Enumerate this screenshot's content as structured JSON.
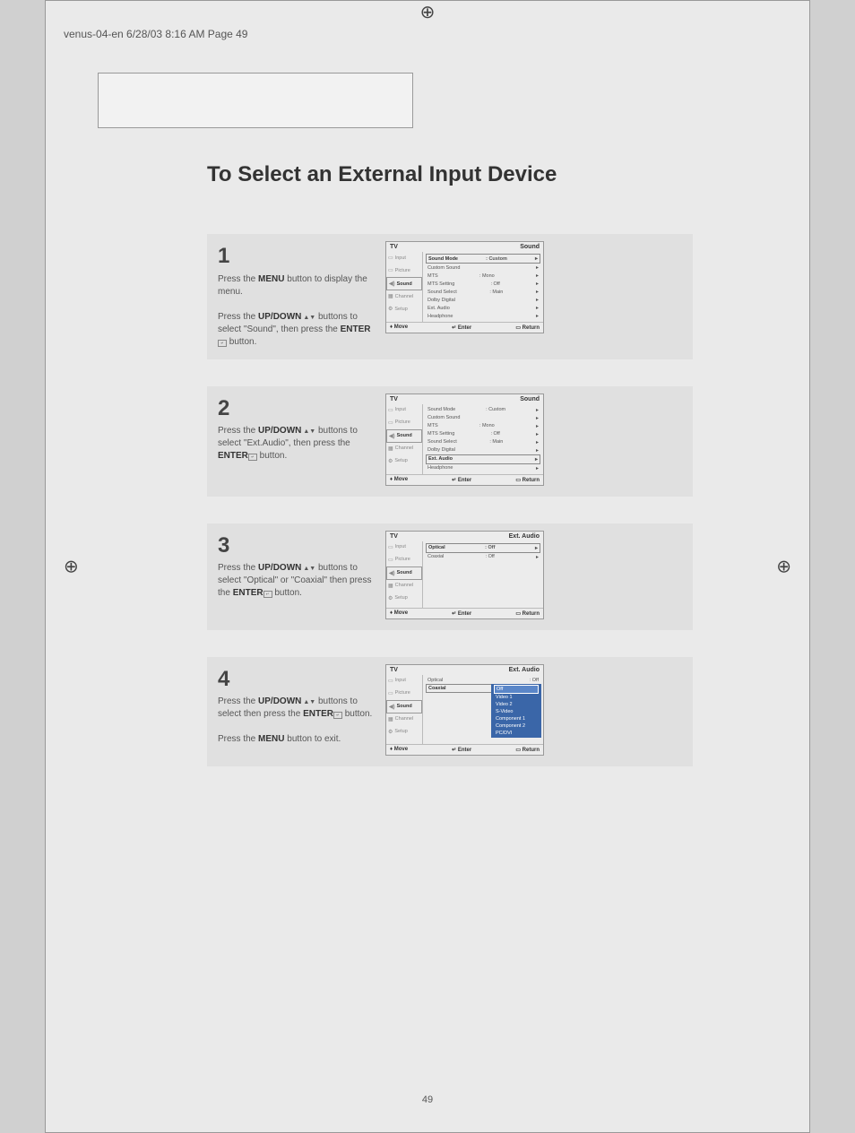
{
  "header_line": "venus-04-en  6/28/03 8:16 AM  Page 49",
  "title": "To Select an External Input Device",
  "page_number": "49",
  "steps": {
    "s1": {
      "num": "1",
      "text_a": "Press the ",
      "text_b": "MENU",
      "text_c": " button to display the menu.",
      "text_d": "Press the ",
      "text_e": "UP/DOWN",
      "text_f": " buttons to select \"Sound\", then press the ",
      "text_g": "ENTER",
      "text_h": " button."
    },
    "s2": {
      "num": "2",
      "text_a": "Press the ",
      "text_b": "UP/DOWN",
      "text_c": " buttons to select \"Ext.Audio\", then press the ",
      "text_d": "ENTER",
      "text_e": " button."
    },
    "s3": {
      "num": "3",
      "text_a": "Press the ",
      "text_b": "UP/DOWN",
      "text_c": " buttons to select \"Optical\" or \"Coaxial\" then press the ",
      "text_d": "ENTER",
      "text_e": " button."
    },
    "s4": {
      "num": "4",
      "text_a": "Press the ",
      "text_b": "UP/DOWN",
      "text_c": " buttons to select then press the ",
      "text_d": "ENTER",
      "text_e": " button.",
      "text_f": "Press the ",
      "text_g": "MENU",
      "text_h": " button to exit."
    }
  },
  "osd_common": {
    "tv": "TV",
    "footer_move": "Move",
    "footer_enter": "Enter",
    "footer_return": "Return",
    "sidebar": {
      "input": "Input",
      "picture": "Picture",
      "sound": "Sound",
      "channel": "Channel",
      "setup": "Setup"
    }
  },
  "osd1": {
    "title_right": "Sound",
    "rows": [
      {
        "label": "Sound Mode",
        "value": "Custom",
        "sel": true
      },
      {
        "label": "Custom Sound",
        "value": ""
      },
      {
        "label": "MTS",
        "value": "Mono"
      },
      {
        "label": "MTS Setting",
        "value": "Off"
      },
      {
        "label": "Sound Select",
        "value": "Main"
      },
      {
        "label": "Dolby Digital",
        "value": ""
      },
      {
        "label": "Ext. Audio",
        "value": ""
      },
      {
        "label": "Headphone",
        "value": ""
      }
    ]
  },
  "osd2": {
    "title_right": "Sound",
    "rows": [
      {
        "label": "Sound Mode",
        "value": "Custom"
      },
      {
        "label": "Custom Sound",
        "value": ""
      },
      {
        "label": "MTS",
        "value": "Mono"
      },
      {
        "label": "MTS Setting",
        "value": "Off"
      },
      {
        "label": "Sound Select",
        "value": "Main"
      },
      {
        "label": "Dolby Digital",
        "value": ""
      },
      {
        "label": "Ext. Audio",
        "value": "",
        "sel": true
      },
      {
        "label": "Headphone",
        "value": ""
      }
    ]
  },
  "osd3": {
    "title_right": "Ext. Audio",
    "rows": [
      {
        "label": "Optical",
        "value": "Off",
        "sel": true
      },
      {
        "label": "Coaxial",
        "value": "Off"
      }
    ]
  },
  "osd4": {
    "title_right": "Ext. Audio",
    "rows": [
      {
        "label": "Optical",
        "value": "Off"
      },
      {
        "label": "Coaxial",
        "value": ""
      }
    ],
    "dropdown": [
      {
        "label": "Off",
        "sel": true
      },
      {
        "label": "Video 1"
      },
      {
        "label": "Video 2"
      },
      {
        "label": "S-Video"
      },
      {
        "label": "Component 1"
      },
      {
        "label": "Component 2"
      },
      {
        "label": "PC/DVI"
      }
    ]
  }
}
